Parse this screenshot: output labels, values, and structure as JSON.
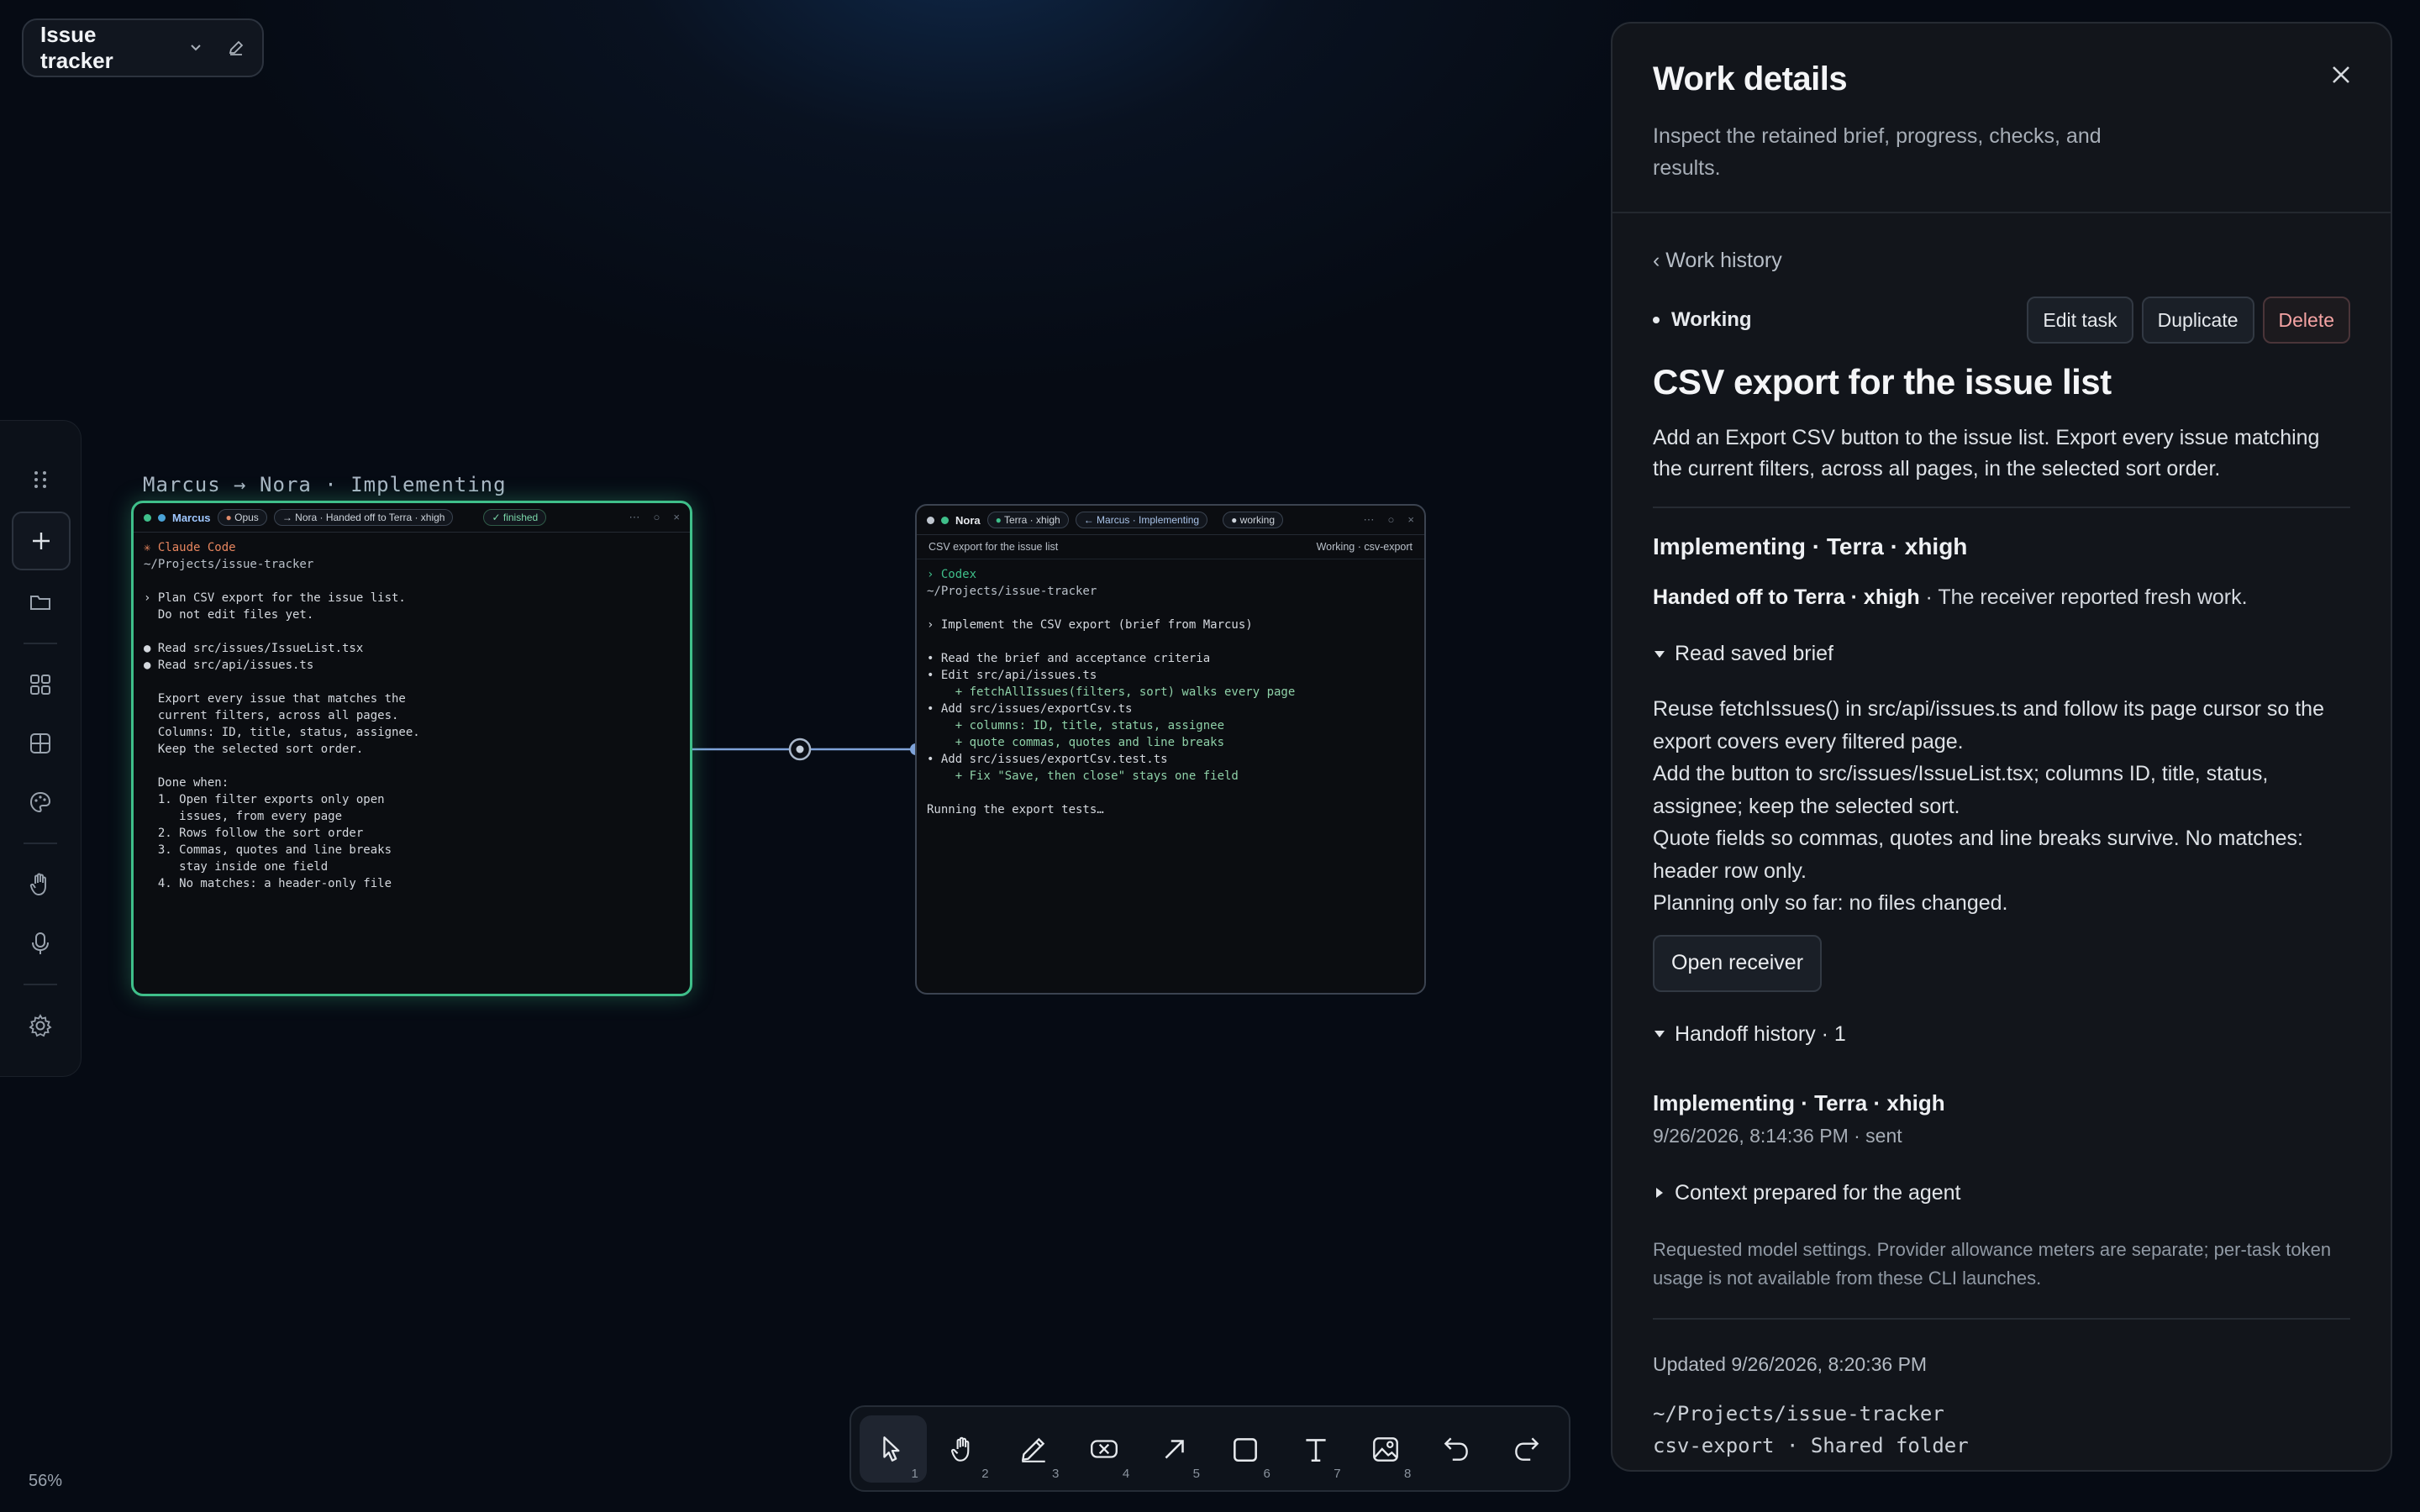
{
  "project": {
    "name": "Issue tracker"
  },
  "canvas": {
    "zoom": "56%",
    "link_caption": "Marcus → Nora · Implementing",
    "term1": {
      "agent": "Marcus",
      "model": "Opus",
      "handoff_chip": "→ Nora · Handed off to Terra · xhigh",
      "state": "✓ finished",
      "lines": [
        "✳ Claude Code",
        "~/Projects/issue-tracker",
        "",
        "› Plan CSV export for the issue list.",
        "  Do not edit files yet.",
        "",
        "● Read src/issues/IssueList.tsx",
        "● Read src/api/issues.ts",
        "",
        "  Export every issue that matches the",
        "  current filters, across all pages.",
        "  Columns: ID, title, status, assignee.",
        "  Keep the selected sort order.",
        "",
        "  Done when:",
        "  1. Open filter exports only open",
        "     issues, from every page",
        "  2. Rows follow the sort order",
        "  3. Commas, quotes and line breaks",
        "     stay inside one field",
        "  4. No matches: a header-only file"
      ]
    },
    "term2": {
      "agent": "Nora",
      "model": "Terra · xhigh",
      "handoff_chip": "← Marcus · Implementing",
      "state": "● working",
      "task": "CSV export for the issue list",
      "branch": "Working · csv-export",
      "lines": [
        "› Codex",
        "~/Projects/issue-tracker",
        "",
        "› Implement the CSV export (brief from Marcus)",
        "",
        "• Read the brief and acceptance criteria",
        "• Edit src/api/issues.ts",
        "    + fetchAllIssues(filters, sort) walks every page",
        "• Add src/issues/exportCsv.ts",
        "    + columns: ID, title, status, assignee",
        "    + quote commas, quotes and line breaks",
        "• Add src/issues/exportCsv.test.ts",
        "    + Fix \"Save, then close\" stays one field",
        "",
        "Running the export tests…"
      ]
    }
  },
  "toolbar": {
    "tools": [
      {
        "icon": "pointer-icon",
        "key": "1"
      },
      {
        "icon": "hand-icon",
        "key": "2"
      },
      {
        "icon": "pencil-icon",
        "key": "3"
      },
      {
        "icon": "eraser-icon",
        "key": "4"
      },
      {
        "icon": "arrow-icon",
        "key": "5"
      },
      {
        "icon": "rectangle-icon",
        "key": "6"
      },
      {
        "icon": "text-icon",
        "key": "7"
      },
      {
        "icon": "image-icon",
        "key": "8"
      },
      {
        "icon": "undo-icon",
        "key": ""
      },
      {
        "icon": "redo-icon",
        "key": ""
      }
    ]
  },
  "panel": {
    "title": "Work details",
    "subtitle": "Inspect the retained brief, progress, checks, and results.",
    "back": "‹ Work history",
    "status": "Working",
    "edit": "Edit task",
    "duplicate": "Duplicate",
    "delete": "Delete",
    "task_title": "CSV export for the issue list",
    "task_desc": "Add an Export CSV button to the issue list. Export every issue matching the current filters, across all pages, in the selected sort order.",
    "stage": "Implementing · Terra · xhigh",
    "handoff_bold": "Handed off to Terra · xhigh",
    "handoff_rest": " · The receiver reported fresh work.",
    "brief_toggle": "Read saved brief",
    "brief": [
      "Reuse fetchIssues() in src/api/issues.ts and follow its page cursor so the export covers every filtered page.",
      "Add the button to src/issues/IssueList.tsx; columns ID, title, status, assignee; keep the selected sort.",
      "Quote fields so commas, quotes and line breaks survive. No matches: header row only.",
      "Planning only so far: no files changed."
    ],
    "open_receiver": "Open receiver",
    "history_toggle": "Handoff history · 1",
    "event_title": "Implementing · Terra · xhigh",
    "event_meta": "9/26/2026, 8:14:36 PM · sent",
    "context_toggle": "Context prepared for the agent",
    "note": "Requested model settings. Provider allowance meters are separate; per-task token usage is not available from these CLI launches.",
    "updated": "Updated 9/26/2026, 8:20:36 PM",
    "path": "~/Projects/issue-tracker",
    "path2": "csv-export · Shared folder"
  },
  "colors": {
    "accent_green": "#3fbf8a",
    "link_blue": "#7fa3d9"
  }
}
